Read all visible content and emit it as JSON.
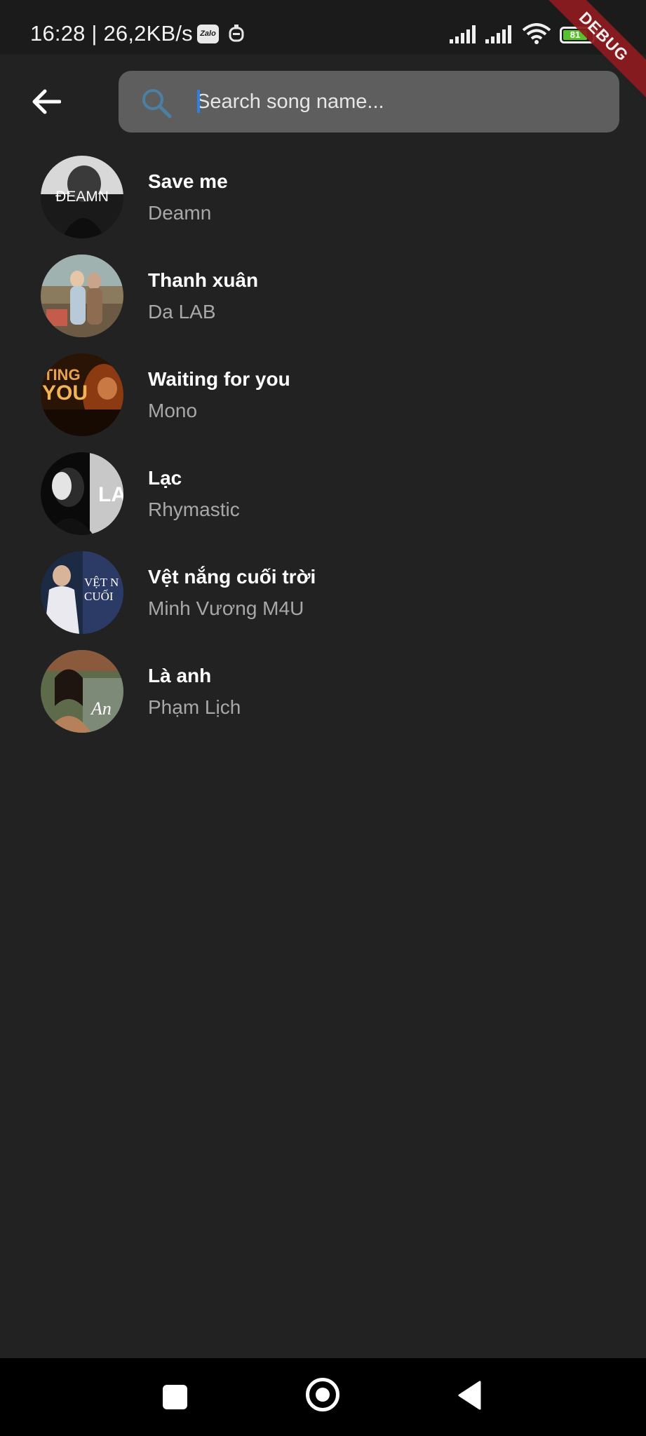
{
  "status_bar": {
    "time_and_speed": "16:28 | 26,2KB/s",
    "zalo_label": "Zalo",
    "battery_level": "81"
  },
  "debug_banner": "DEBUG",
  "search": {
    "placeholder": "Search song name...",
    "value": ""
  },
  "songs": [
    {
      "title": "Save me",
      "artist": "Deamn",
      "cover_text": "ĐEAMN"
    },
    {
      "title": "Thanh xuân",
      "artist": "Da LAB",
      "cover_text": ""
    },
    {
      "title": "Waiting for you",
      "artist": "Mono",
      "cover_text": "TING YOU"
    },
    {
      "title": "Lạc",
      "artist": "Rhymastic",
      "cover_text": "LA"
    },
    {
      "title": "Vệt nắng cuối trời",
      "artist": "Minh Vương M4U",
      "cover_text": "VỆT N CUỐI"
    },
    {
      "title": "Là anh",
      "artist": "Phạm Lịch",
      "cover_text": "Anh"
    }
  ],
  "icons": {
    "back": "arrow-left-icon",
    "search": "search-icon",
    "nav_recents": "square-icon",
    "nav_home": "circle-icon",
    "nav_back": "triangle-back-icon"
  },
  "colors": {
    "background": "#222222",
    "search_box": "#5e5e5e",
    "artist_text": "#a8a8a8",
    "debug_banner": "#8e1b1f",
    "battery_fill": "#57c22b",
    "caret": "#2f7fe6"
  }
}
